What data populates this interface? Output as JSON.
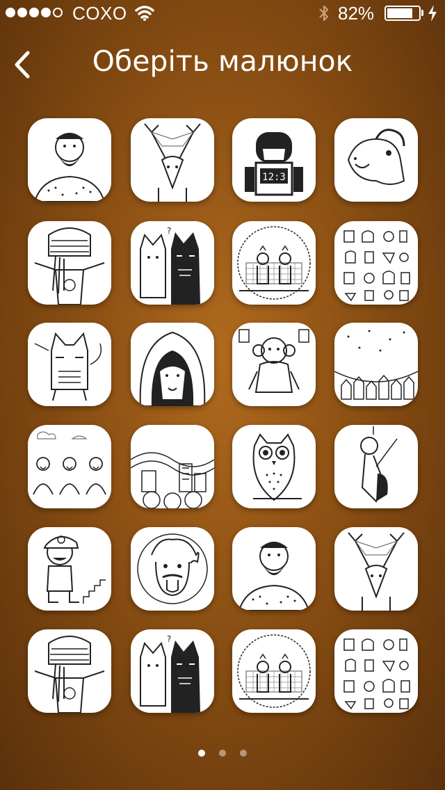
{
  "status_bar": {
    "carrier": "COXO",
    "battery_percent": "82%",
    "signal_bars_filled": 4,
    "signal_bars_total": 5,
    "battery_level": 0.82
  },
  "nav": {
    "title": "Оберіть малюнок",
    "back_icon": "chevron-left-icon"
  },
  "tiles": [
    {
      "icon": "bearded-man-drawing"
    },
    {
      "icon": "deer-drawing"
    },
    {
      "icon": "robot-clock-drawing"
    },
    {
      "icon": "horse-drawing"
    },
    {
      "icon": "rasta-man-drawing"
    },
    {
      "icon": "two-cats-drawing"
    },
    {
      "icon": "couple-drawing"
    },
    {
      "icon": "pattern-drawing"
    },
    {
      "icon": "cat-drawing"
    },
    {
      "icon": "hooded-lion-drawing"
    },
    {
      "icon": "monkey-drawing"
    },
    {
      "icon": "town-drawing"
    },
    {
      "icon": "three-men-drawing"
    },
    {
      "icon": "city-waves-drawing"
    },
    {
      "icon": "owl-drawing"
    },
    {
      "icon": "astronaut-drawing"
    },
    {
      "icon": "plumber-drawing"
    },
    {
      "icon": "einstein-drawing"
    },
    {
      "icon": "bearded-man-drawing"
    },
    {
      "icon": "deer-drawing"
    },
    {
      "icon": "rasta-man-drawing"
    },
    {
      "icon": "two-cats-drawing"
    },
    {
      "icon": "couple-drawing"
    },
    {
      "icon": "pattern-drawing"
    }
  ],
  "pager": {
    "pages": 3,
    "current": 1
  }
}
